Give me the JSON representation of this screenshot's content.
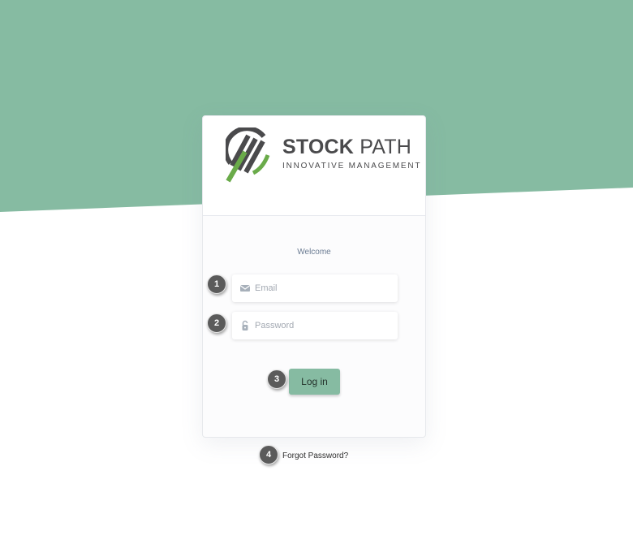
{
  "brand": {
    "name_bold": "STOCK",
    "name_regular": "PATH",
    "tagline": "INNOVATIVE MANAGEMENT",
    "logo_icon": "stock-path-logo-icon"
  },
  "login": {
    "welcome": "Welcome",
    "email": {
      "placeholder": "Email",
      "value": "",
      "icon": "envelope-icon"
    },
    "password": {
      "placeholder": "Password",
      "value": "",
      "icon": "lock-icon"
    },
    "submit_label": "Log in",
    "forgot_label": "Forgot Password?"
  },
  "callouts": [
    "1",
    "2",
    "3",
    "4"
  ],
  "colors": {
    "accent": "#86bba2",
    "background_band": "#86bba2",
    "logo_gray": "#4a4a4c",
    "logo_green": "#6aab4a",
    "badge": "#5b5b5b"
  }
}
